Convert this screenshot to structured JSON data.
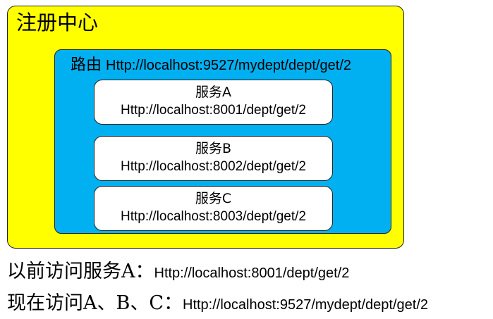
{
  "registry": {
    "title": "注册中心"
  },
  "router": {
    "label": "路由",
    "url": "Http://localhost:9527/mydept/dept/get/2"
  },
  "services": [
    {
      "name": "服务A",
      "url": "Http://localhost:8001/dept/get/2"
    },
    {
      "name": "服务B",
      "url": "Http://localhost:8002/dept/get/2"
    },
    {
      "name": "服务C",
      "url": "Http://localhost:8003/dept/get/2"
    }
  ],
  "notes": {
    "before": {
      "label": "以前访问服务A：",
      "url": "Http://localhost:8001/dept/get/2"
    },
    "now": {
      "label": "现在访问A、B、C：",
      "url": "Http://localhost:9527/mydept/dept/get/2"
    }
  },
  "colors": {
    "registry_fill": "#ffff00",
    "router_fill": "#00b0f0",
    "service_fill": "#ffffff"
  }
}
